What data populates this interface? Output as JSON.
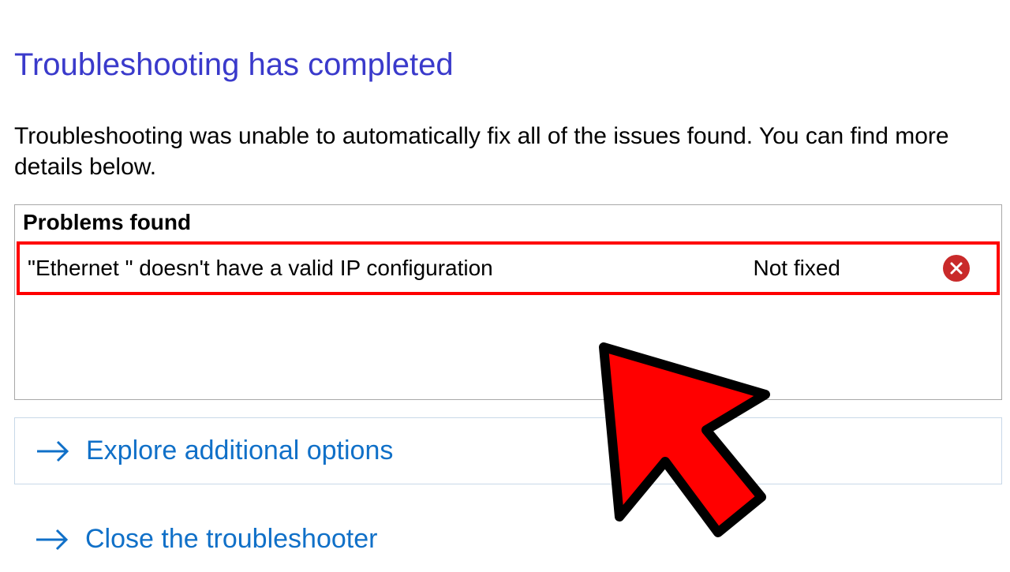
{
  "title": "Troubleshooting has completed",
  "description": "Troubleshooting was unable to automatically fix all of the issues found. You can find more details below.",
  "problems": {
    "header": "Problems found",
    "items": [
      {
        "description": "\"Ethernet \" doesn't have a valid IP configuration",
        "status": "Not fixed"
      }
    ]
  },
  "options": {
    "explore": "Explore additional options",
    "close": "Close the troubleshooter"
  }
}
